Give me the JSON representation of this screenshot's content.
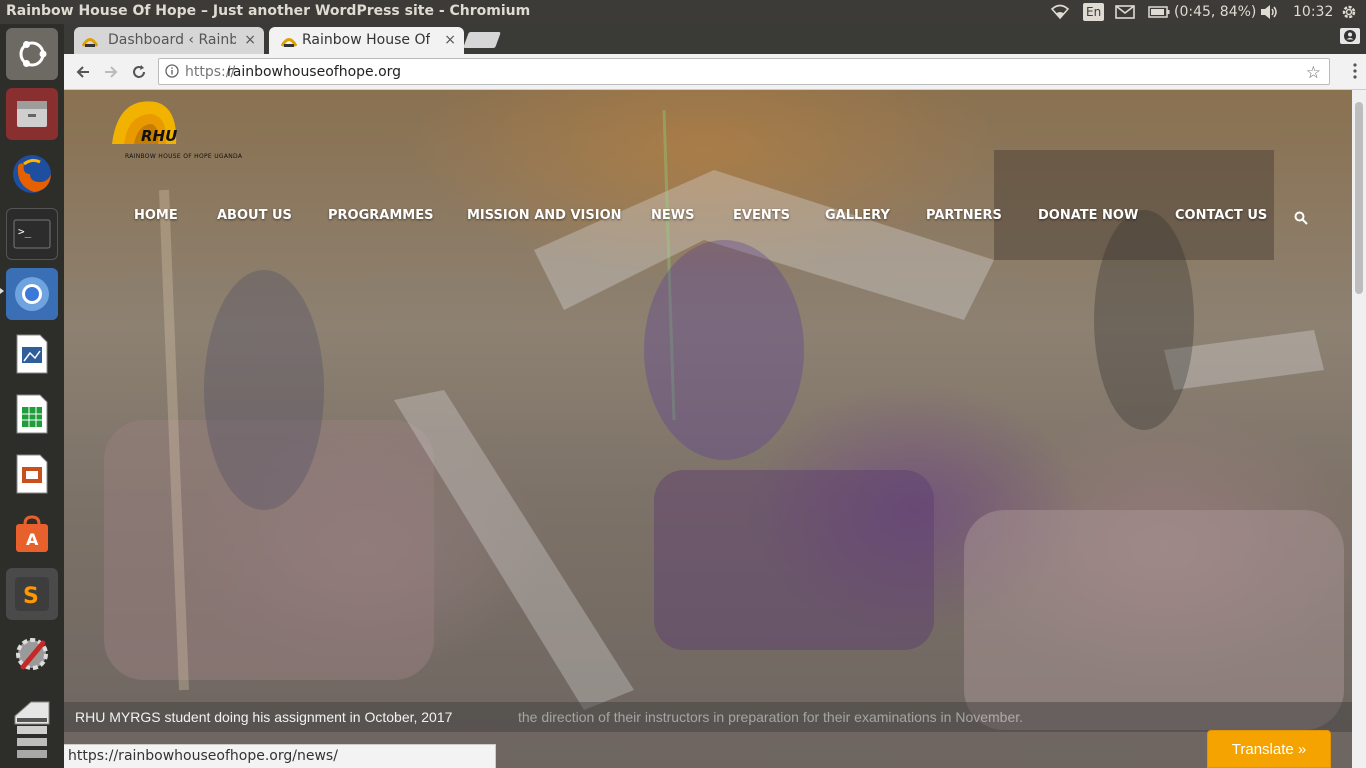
{
  "window": {
    "title": "Rainbow House Of Hope – Just another WordPress site - Chromium"
  },
  "tray": {
    "keyboard": "En",
    "battery": "(0:45, 84%)",
    "clock": "10:32"
  },
  "launcher": {
    "items": [
      "ubuntu-dash",
      "files",
      "firefox",
      "terminal",
      "chromium",
      "libreoffice-impress",
      "libreoffice-calc",
      "libreoffice-impress-2",
      "software-center",
      "sublime-text",
      "system-settings",
      "scanner",
      "stack"
    ]
  },
  "tabs": [
    {
      "label": "Dashboard ‹ Rainbo",
      "close": "×",
      "active": false
    },
    {
      "label": "Rainbow House Of",
      "close": "×",
      "active": true
    }
  ],
  "omnibox": {
    "scheme": "https://",
    "host": "rainbowhouseofhope.org",
    "full": "https://rainbowhouseofhope.org"
  },
  "site": {
    "logo_text": "RHU",
    "logo_tagline": "RAINBOW HOUSE OF HOPE UGANDA",
    "nav": [
      "HOME",
      "ABOUT US",
      "PROGRAMMES",
      "MISSION AND VISION",
      "NEWS",
      "EVENTS",
      "GALLERY",
      "PARTNERS",
      "DONATE NOW",
      "CONTACT US"
    ],
    "caption_primary": "RHU MYRGS student doing his assignment in October, 2017",
    "caption_secondary": "the direction of their instructors in preparation for their examinations in November.",
    "translate_label": "Translate »"
  },
  "status_url": "https://rainbowhouseofhope.org/news/",
  "colors": {
    "panel": "#3c3b37",
    "launcher": "#2d2d2a",
    "translate": "#f4a300"
  }
}
